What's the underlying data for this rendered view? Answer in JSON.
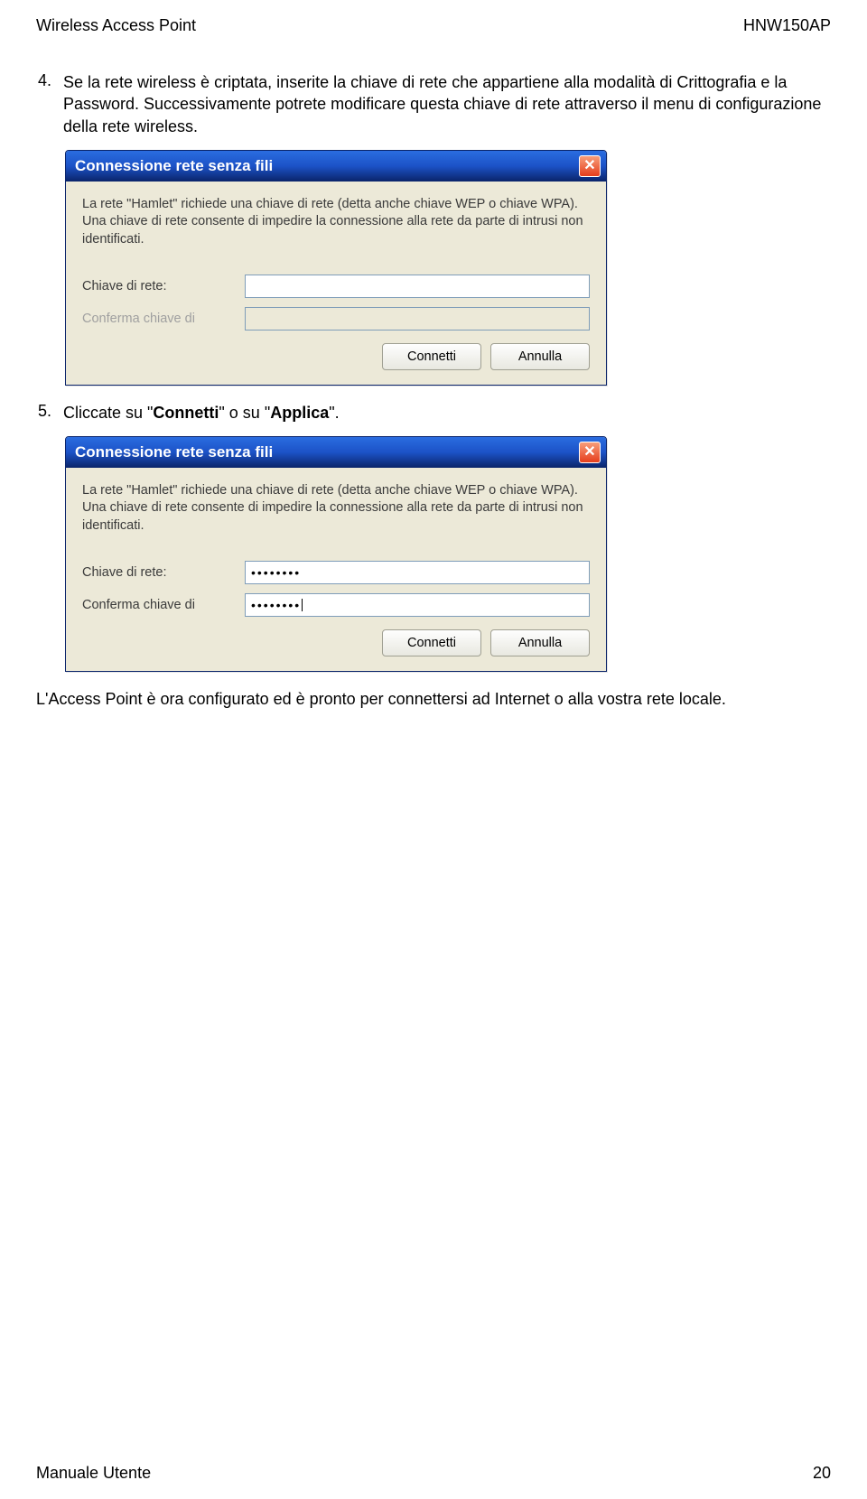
{
  "header": {
    "left": "Wireless Access Point",
    "right": "HNW150AP"
  },
  "item4": {
    "num": "4.",
    "text": "Se la rete wireless è criptata, inserite la chiave di rete che appartiene alla modalità di Crittografia e la Password. Successivamente potrete modificare questa chiave di rete attraverso il menu di configurazione della rete wireless."
  },
  "dialog1": {
    "title": "Connessione rete senza fili",
    "explain": "La rete \"Hamlet\" richiede una chiave di rete (detta anche chiave WEP o chiave WPA). Una chiave di rete consente di impedire la connessione alla rete da parte di intrusi non identificati.",
    "key_label": "Chiave di rete:",
    "confirm_label": "Conferma chiave di",
    "key_value": "",
    "confirm_value": "",
    "btn_connect": "Connetti",
    "btn_cancel": "Annulla",
    "close_icon": "✕"
  },
  "item5": {
    "num": "5.",
    "text_pre": "Cliccate su \"",
    "bold1": "Connetti",
    "text_mid": "\" o su \"",
    "bold2": "Applica",
    "text_post": "\"."
  },
  "dialog2": {
    "title": "Connessione rete senza fili",
    "explain": "La rete \"Hamlet\" richiede una chiave di rete (detta anche chiave WEP o chiave WPA). Una chiave di rete consente di impedire la connessione alla rete da parte di intrusi non identificati.",
    "key_label": "Chiave di rete:",
    "confirm_label": "Conferma chiave di",
    "key_value": "••••••••",
    "confirm_value": "••••••••",
    "btn_connect": "Connetti",
    "btn_cancel": "Annulla",
    "close_icon": "✕"
  },
  "closing_text": "L'Access Point è ora configurato ed è pronto per connettersi ad Internet o alla vostra rete locale.",
  "footer": {
    "left": "Manuale Utente",
    "right": "20"
  }
}
